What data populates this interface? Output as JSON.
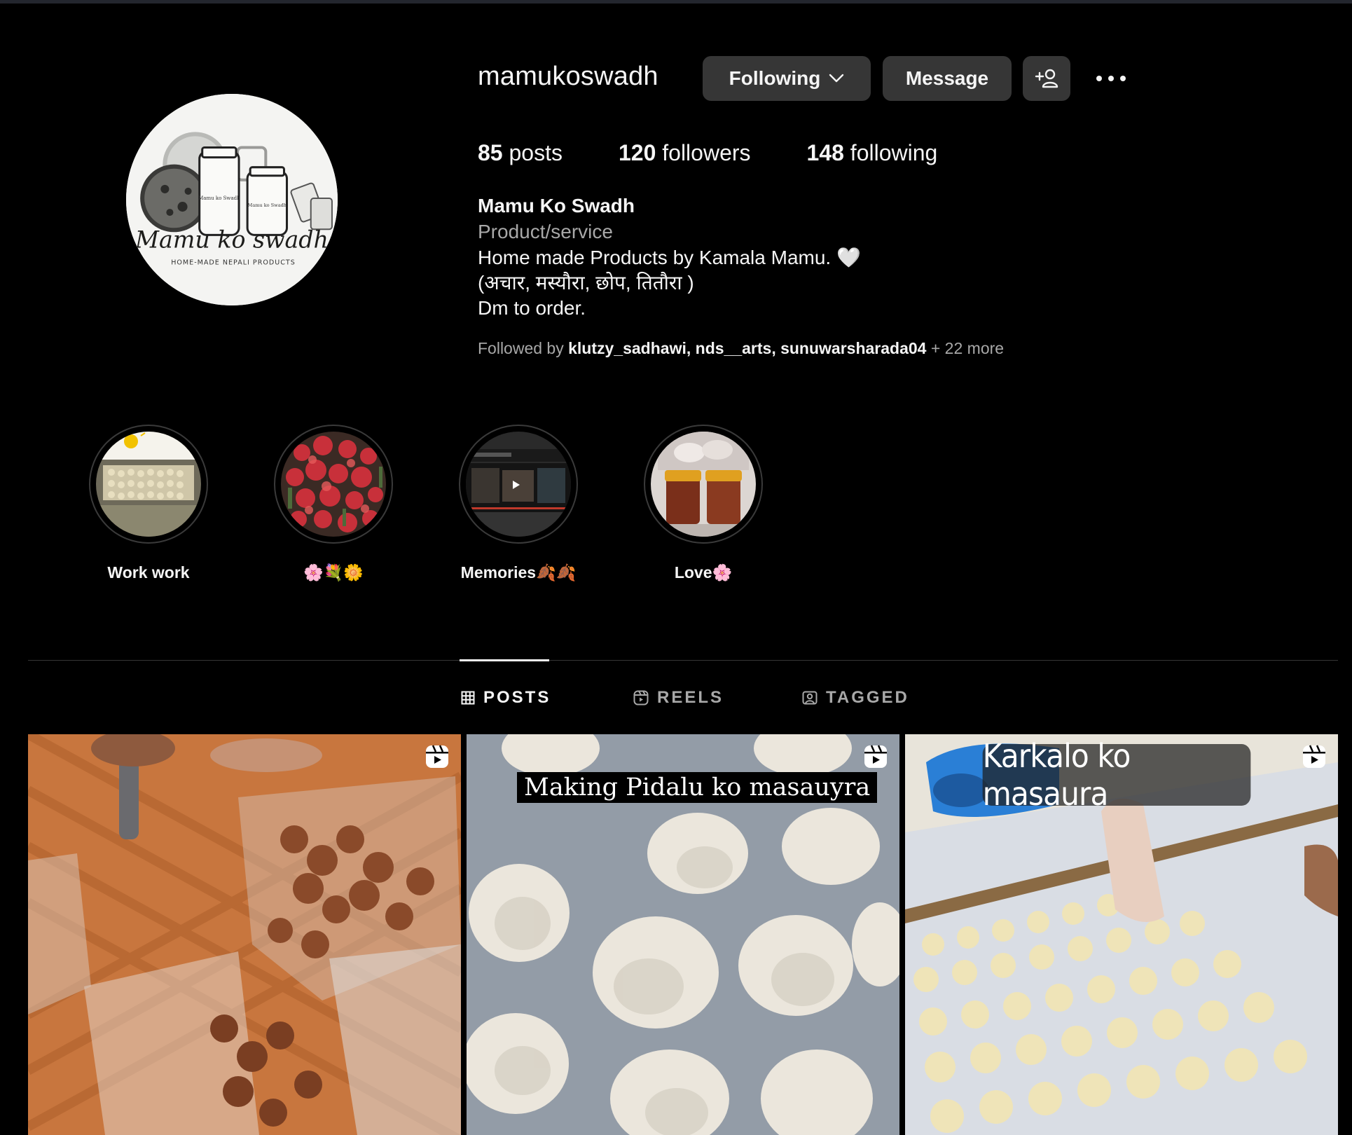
{
  "profile": {
    "username": "mamukoswadh",
    "avatar_text_title": "Mamu ko swadh",
    "avatar_text_sub": "HOME-MADE NEPALI PRODUCTS",
    "avatar_jar_label": "Mamu ko Swadh",
    "full_name": "Mamu Ko Swadh",
    "category": "Product/service",
    "bio_lines": [
      "Home made Products by Kamala Mamu. 🤍",
      "(अचार, मस्यौरा, छोप, तितौरा )",
      "Dm to order."
    ]
  },
  "actions": {
    "following_label": "Following",
    "message_label": "Message"
  },
  "stats": {
    "posts_count": "85",
    "posts_label": "posts",
    "followers_count": "120",
    "followers_label": "followers",
    "following_count": "148",
    "following_label": "following"
  },
  "followed_by": {
    "prefix": "Followed by",
    "users": [
      "klutzy_sadhawi",
      "nds__arts",
      "sunuwarsharada04"
    ],
    "more": "+ 22 more"
  },
  "highlights": [
    {
      "label": "Work work"
    },
    {
      "label": "🌸💐🌼"
    },
    {
      "label": "Memories🍂🍂"
    },
    {
      "label": "Love🌸"
    }
  ],
  "tabs": [
    {
      "label": "POSTS",
      "active": true
    },
    {
      "label": "REELS",
      "active": false
    },
    {
      "label": "TAGGED",
      "active": false
    }
  ],
  "posts": [
    {
      "caption": "",
      "icon": "reel-icon"
    },
    {
      "caption": "Making Pidalu ko masauyra",
      "icon": "reel-icon"
    },
    {
      "caption": "Karkalo ko masaura",
      "icon": "reel-icon"
    }
  ],
  "colors": {
    "background": "#000000",
    "button": "#363636",
    "muted_text": "#a8a8a8",
    "primary_text": "#f5f5f5"
  }
}
